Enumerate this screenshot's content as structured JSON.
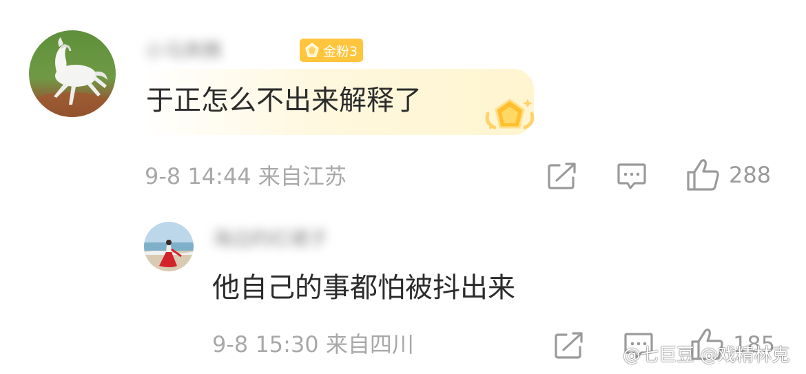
{
  "comments": [
    {
      "username": "小马奔腾",
      "badge": {
        "label": "金粉3",
        "color": "#ffc53d"
      },
      "text": "于正怎么不出来解释了",
      "time": "9-8 14:44",
      "location": "来自江苏",
      "likes": "288"
    },
    {
      "username": "海边的红裙子",
      "text": "他自己的事都怕被抖出来",
      "time": "9-8 15:30",
      "location": "来自四川",
      "likes": "185"
    }
  ],
  "watermark": {
    "text": "@七巨豆 @戏精林克"
  },
  "colors": {
    "meta_text": "#a8a8a8",
    "body_text": "#2b2b2b",
    "icon_stroke": "#9a9a9a",
    "badge_gold": "#ffc53d"
  }
}
